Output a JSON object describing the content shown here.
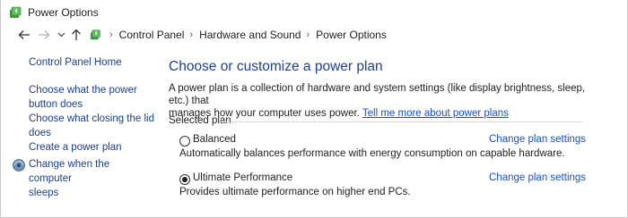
{
  "window": {
    "title": "Power Options"
  },
  "addressbar": {
    "crumbs": [
      "Control Panel",
      "Hardware and Sound",
      "Power Options"
    ]
  },
  "sidebar": {
    "home": "Control Panel Home",
    "links": [
      {
        "line1": "Choose what the power",
        "line2": "button does"
      },
      {
        "line1": "Choose what closing the lid",
        "line2": "does"
      },
      {
        "line1": "Create a power plan",
        "line2": ""
      },
      {
        "line1": "Change when the computer",
        "line2": "sleeps"
      }
    ]
  },
  "main": {
    "heading": "Choose or customize a power plan",
    "description_line1": "A power plan is a collection of hardware and system settings (like display brightness, sleep, etc.) that",
    "description_line2": "manages how your computer uses power.",
    "description_link": "Tell me more about power plans",
    "group_label": "Selected plan",
    "plans": [
      {
        "name": "Balanced",
        "description": "Automatically balances performance with energy consumption on capable hardware.",
        "settings_link": "Change plan settings",
        "selected": false
      },
      {
        "name": "Ultimate Performance",
        "description": "Provides ultimate performance on higher end PCs.",
        "settings_link": "Change plan settings",
        "selected": true
      }
    ]
  },
  "colors": {
    "heading": "#1e3f8e",
    "link": "#1a4fc4",
    "sidebar_link": "#1a3e8c"
  },
  "icons": {
    "app": "power-options-icon",
    "back": "back-arrow-icon",
    "forward": "forward-arrow-icon",
    "recent": "chevron-down-icon",
    "up": "up-arrow-icon",
    "sidebar_sleep": "shield-icon"
  }
}
